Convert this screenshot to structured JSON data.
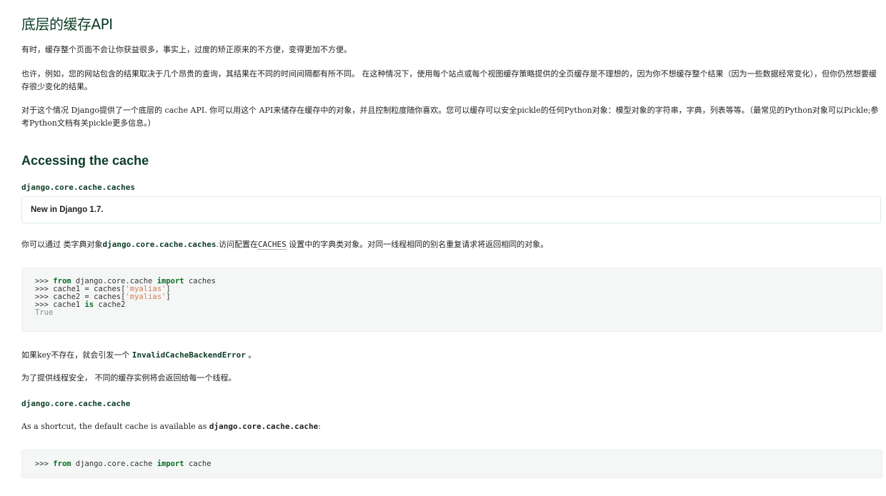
{
  "title": "底层的缓存API",
  "paragraphs": {
    "p1": "有时，缓存整个页面不会让你获益很多，事实上，过度的矫正原来的不方便，变得更加不方便。",
    "p2": "也许，例如，您的网站包含的结果取决于几个昂贵的查询，其结果在不同的时间间隔都有所不同。 在这种情况下，使用每个站点或每个视图缓存策略提供的全页缓存是不理想的，因为你不想缓存整个结果（因为一些数据经常变化），但你仍然想要缓存很少变化的结果。",
    "p3": "对于这个情况 Django提供了一个底层的 cache API. 你可以用这个 API来储存在缓存中的对象，并且控制粒度随你喜欢。您可以缓存可以安全pickle的任何Python对象：模型对象的字符串，字典，列表等等。（最常见的Python对象可以Pickle;参考Python文档有关pickle更多信息。）"
  },
  "section": {
    "heading": "Accessing the cache",
    "caches_label": "django.core.cache.caches",
    "version_note": "New in Django 1.7.",
    "caches_desc_1": "你可以通过 类字典对象",
    "caches_desc_code": "django.core.cache.caches",
    "caches_desc_2": ".访问配置在",
    "caches_desc_setting": "CACHES",
    "caches_desc_3": " 设置中的字典类对象。对同一线程相同的别名重复请求将返回相同的对象。",
    "code1": {
      "l1_prompt": ">>> ",
      "l1_kw1": "from",
      "l1_mid": " django.core.cache ",
      "l1_kw2": "import",
      "l1_end": " caches",
      "l2_a": ">>> cache1 = caches[",
      "l2_str": "'myalias'",
      "l2_b": "]",
      "l3_a": ">>> cache2 = caches[",
      "l3_str": "'myalias'",
      "l3_b": "]",
      "l4_a": ">>> cache1 ",
      "l4_kw": "is",
      "l4_b": " cache2",
      "l5_out": "True"
    },
    "error_1": "如果key不存在，就会引发一个 ",
    "error_code": "InvalidCacheBackendError",
    "error_2": " 。",
    "thread_note": "为了提供线程安全， 不同的缓存实例将会返回给每一个线程。",
    "cache_label": "django.core.cache.cache",
    "shortcut_1": "As a shortcut, the default cache is available as ",
    "shortcut_code": "django.core.cache.cache",
    "shortcut_2": ":",
    "code2": {
      "prompt": ">>> ",
      "kw1": "from",
      "mid": " django.core.cache ",
      "kw2": "import",
      "end": " cache"
    }
  }
}
